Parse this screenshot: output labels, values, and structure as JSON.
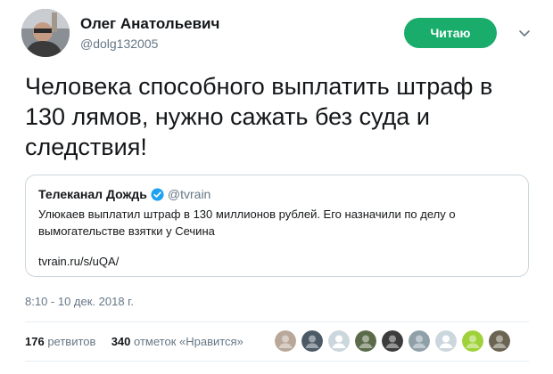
{
  "author": {
    "name": "Олег Анатольевич",
    "handle": "@dolg132005"
  },
  "follow_button": {
    "label": "Читаю",
    "color": "#19ac6b"
  },
  "tweet_text": "Человека способного выплатить штраф в 130 лямов, нужно сажать без суда и следствия!",
  "quoted": {
    "name": "Телеканал Дождь",
    "verified": true,
    "handle": "@tvrain",
    "text": "Улюкаев выплатил штраф в 130 миллионов рублей. Его назначили по делу о вымогательстве взятки у Сечина",
    "link": "tvrain.ru/s/uQA/"
  },
  "timestamp": "8:10 - 10 дек. 2018 г.",
  "stats": {
    "retweets_count": "176",
    "retweets_label": "ретвитов",
    "likes_count": "340",
    "likes_label": "отметок «Нравится»"
  },
  "likers": [
    {
      "icon": "avatar-icon",
      "color": "#b9a89a"
    },
    {
      "icon": "avatar-icon",
      "color": "#4b5a66"
    },
    {
      "icon": "default-avatar-icon",
      "color": "#ccd6dd"
    },
    {
      "icon": "avatar-icon",
      "color": "#5b6b4a"
    },
    {
      "icon": "avatar-icon",
      "color": "#3c3c3c"
    },
    {
      "icon": "avatar-icon",
      "color": "#8fa0a8"
    },
    {
      "icon": "default-avatar-icon",
      "color": "#ccd6dd"
    },
    {
      "icon": "avatar-icon",
      "color": "#9fd23a"
    },
    {
      "icon": "avatar-icon",
      "color": "#6b6453"
    }
  ]
}
